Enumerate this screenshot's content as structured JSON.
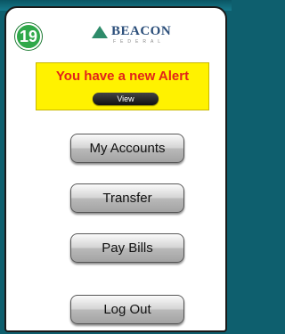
{
  "step_number": "19",
  "logo": {
    "name": "BEACON",
    "sub": "FEDERAL"
  },
  "alert": {
    "message": "You have a new Alert",
    "view_label": "View"
  },
  "menu": {
    "my_accounts": "My Accounts",
    "transfer": "Transfer",
    "pay_bills": "Pay Bills",
    "log_out": "Log Out"
  },
  "colors": {
    "badge": "#2fa84a",
    "alert_bg": "#fff200",
    "alert_text": "#e2231a",
    "frame": "#0e5f6e"
  }
}
